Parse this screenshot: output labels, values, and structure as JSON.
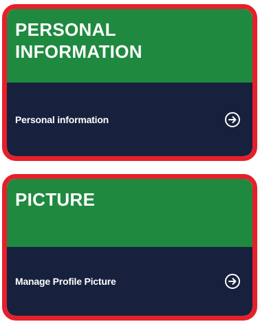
{
  "cards": [
    {
      "title": "PERSONAL INFORMATION",
      "link_label": "Personal information",
      "icon": "arrow-circle-right-icon"
    },
    {
      "title": "PICTURE",
      "link_label": "Manage Profile Picture",
      "icon": "arrow-circle-right-icon"
    }
  ],
  "colors": {
    "border": "#e5202a",
    "header": "#1f8a3f",
    "body": "#17213d",
    "text": "#ffffff"
  }
}
